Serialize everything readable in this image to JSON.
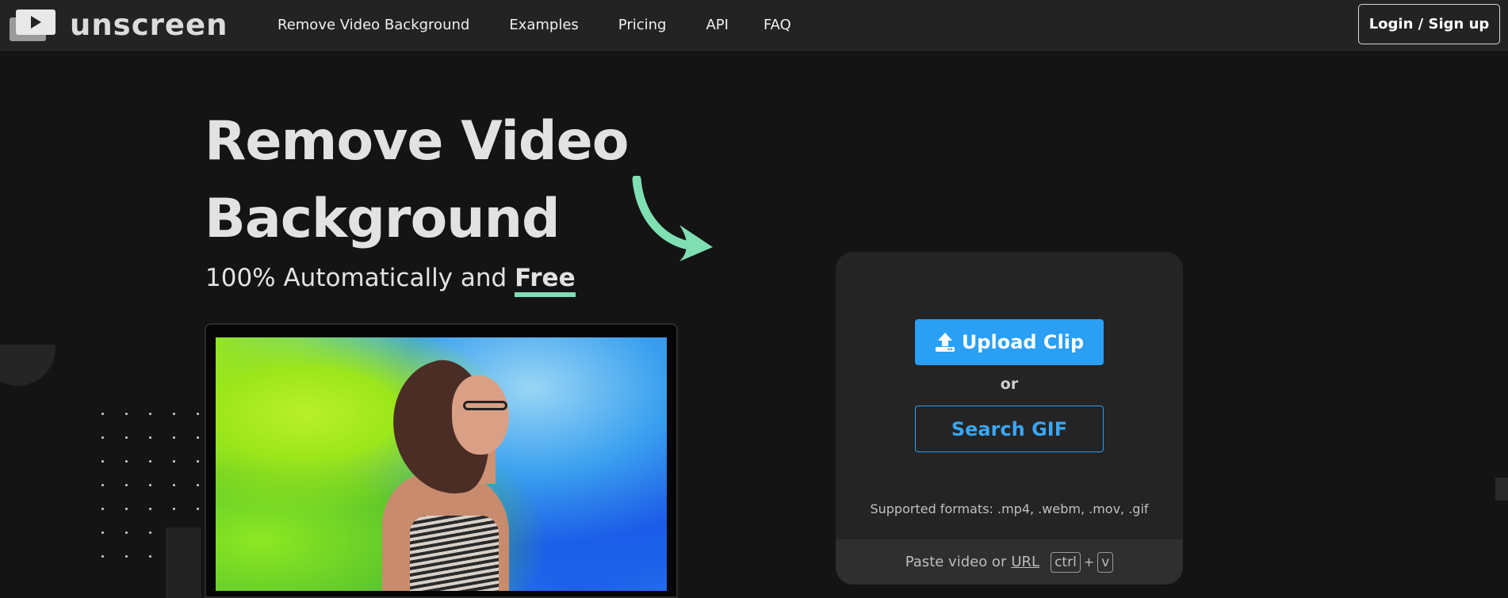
{
  "brand": {
    "name": "unscreen",
    "logo_icon": "play-stack-icon"
  },
  "nav": {
    "items": [
      {
        "label": "Remove Video Background"
      },
      {
        "label": "Examples"
      },
      {
        "label": "Pricing"
      },
      {
        "label": "API"
      },
      {
        "label": "FAQ"
      }
    ],
    "login_label": "Login / Sign up"
  },
  "hero": {
    "title_line1": "Remove Video",
    "title_line2": "Background",
    "subtitle_prefix": "100% Automatically and ",
    "subtitle_emphasis": "Free",
    "accent_color": "#7fdfb3"
  },
  "upload": {
    "upload_label": "Upload Clip",
    "upload_icon": "upload-icon",
    "or_label": "or",
    "search_label": "Search GIF",
    "formats_text": "Supported formats: .mp4, .webm, .mov, .gif",
    "paste_prefix": "Paste video or",
    "paste_url": "URL",
    "key1": "ctrl",
    "plus": "+",
    "key2": "v",
    "button_color": "#2a9ff4"
  }
}
